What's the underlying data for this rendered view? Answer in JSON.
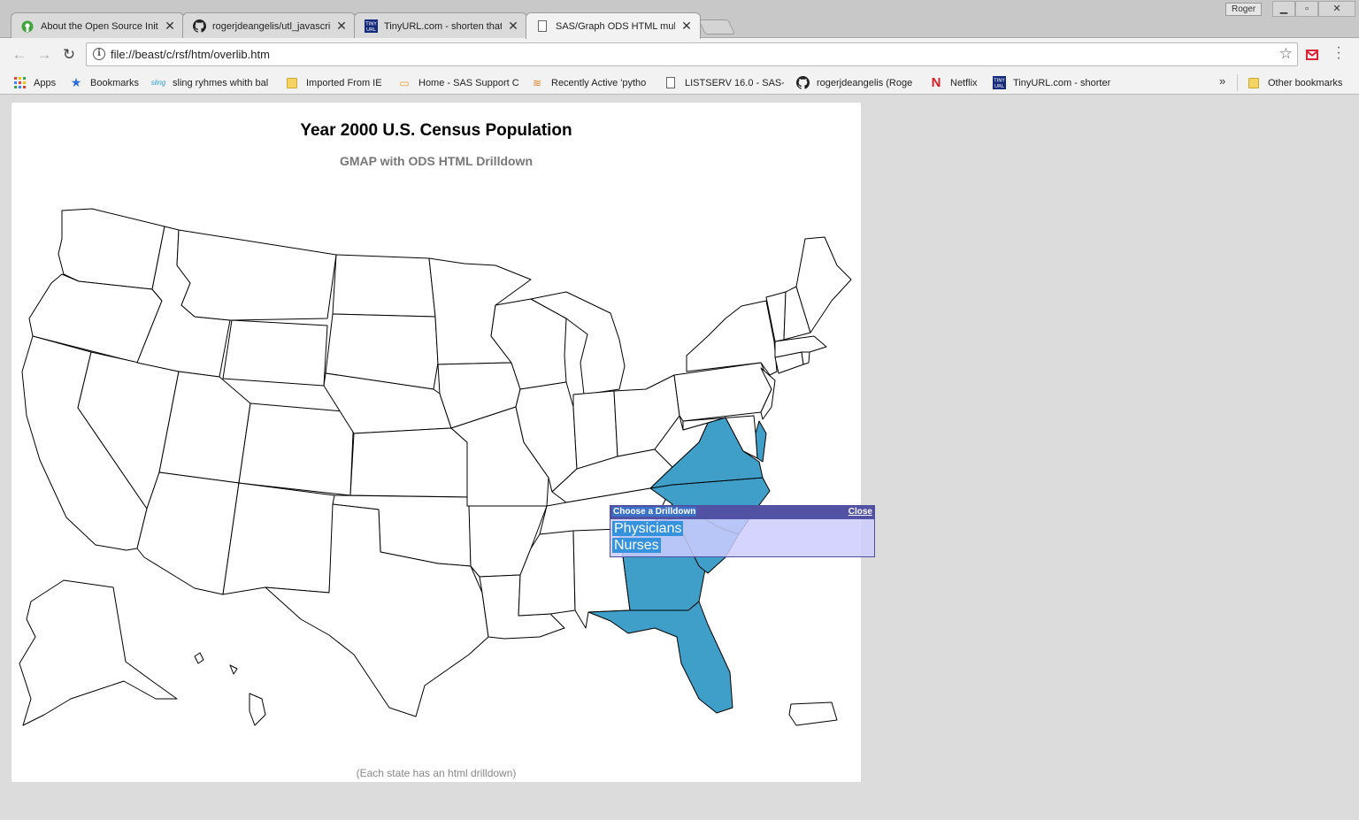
{
  "browser": {
    "tabs": [
      {
        "title": "About the Open Source Init",
        "icon": "osi-icon"
      },
      {
        "title": "rogerjdeangelis/utl_javascri",
        "icon": "github-icon"
      },
      {
        "title": "TinyURL.com - shorten that",
        "icon": "tinyurl-icon"
      },
      {
        "title": "SAS/Graph ODS HTML mult",
        "icon": "page-icon"
      }
    ],
    "active_tab": 3,
    "profile_name": "Roger",
    "address": "file://beast/c/rsf/htm/overlib.htm",
    "bookmarks": [
      {
        "label": "Apps",
        "icon": "apps-icon"
      },
      {
        "label": "Bookmarks",
        "icon": "star-icon"
      },
      {
        "label": "sling ryhmes whith bal",
        "icon": "sling-icon"
      },
      {
        "label": "Imported From IE",
        "icon": "folder-icon"
      },
      {
        "label": "Home - SAS Support C",
        "icon": "sas-icon"
      },
      {
        "label": "Recently Active 'pytho",
        "icon": "stackoverflow-icon"
      },
      {
        "label": "LISTSERV 16.0 - SAS-l",
        "icon": "page-icon"
      },
      {
        "label": "rogerjdeangelis (Roge",
        "icon": "github-icon"
      },
      {
        "label": "Netflix",
        "icon": "netflix-icon"
      },
      {
        "label": "TinyURL.com - shorter",
        "icon": "tinyurl-icon"
      }
    ],
    "other_bookmarks": "Other bookmarks"
  },
  "page": {
    "title": "Year 2000 U.S. Census Population",
    "subtitle": "GMAP with ODS HTML Drilldown",
    "footnote": "(Each state has an html drilldown)",
    "highlight_color": "#3f9fc8",
    "highlighted_states": [
      "Virginia",
      "North Carolina",
      "South Carolina",
      "Georgia",
      "Florida",
      "Delaware"
    ]
  },
  "popup": {
    "caption": "Choose a Drilldown",
    "close_label": "Close",
    "options": [
      "Physicians",
      "Nurses"
    ]
  }
}
